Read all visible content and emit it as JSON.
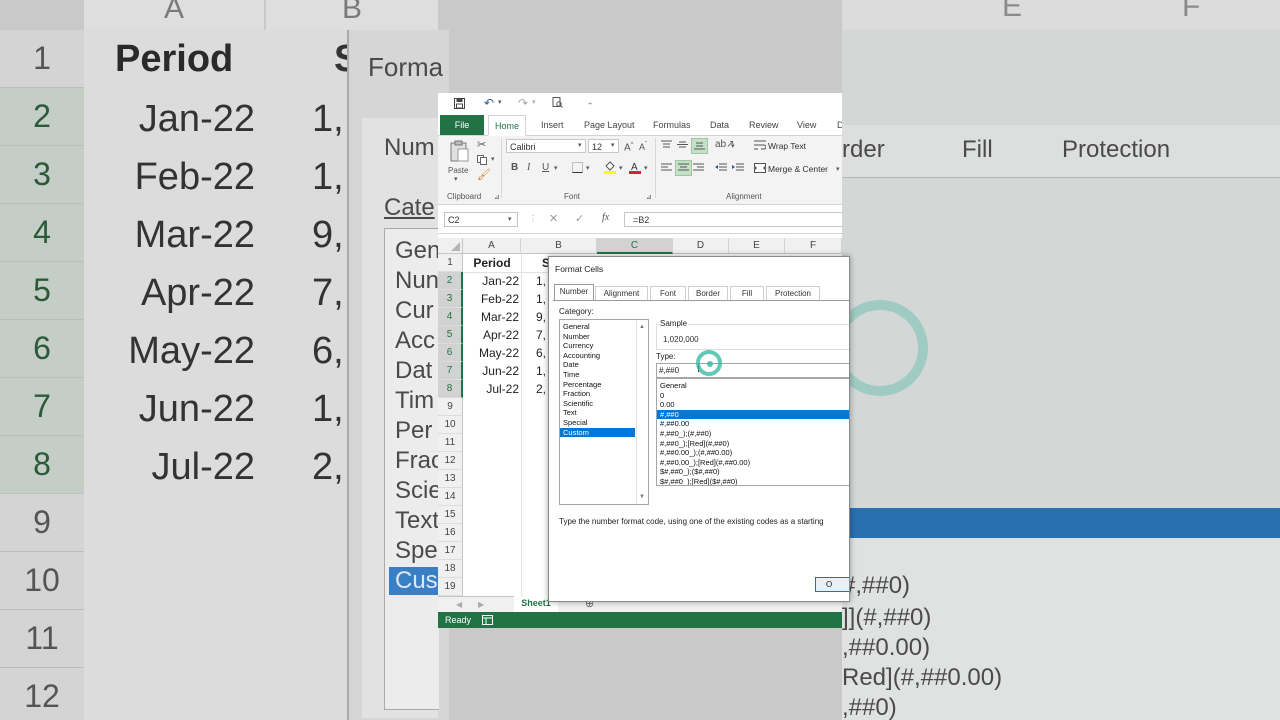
{
  "background": {
    "col_headers": [
      "A",
      "B"
    ],
    "row_numbers": [
      "1",
      "2",
      "3",
      "4",
      "5",
      "6",
      "7",
      "8",
      "9",
      "10",
      "11",
      "12"
    ],
    "period_header": "Period",
    "value_header_partial": "S",
    "periods": [
      "Jan-22",
      "Feb-22",
      "Mar-22",
      "Apr-22",
      "May-22",
      "Jun-22",
      "Jul-22"
    ],
    "value_partials": [
      "1,",
      "1,",
      "9,",
      "7,",
      "6,",
      "1,",
      "2,"
    ],
    "dialog_title_partial": "Forma",
    "number_tab_partial": "Num",
    "category_partial": "Cate",
    "category_partials": [
      "Gen",
      "Nun",
      "Cur",
      "Acc",
      "Dat",
      "Tim",
      "Per",
      "Frac",
      "Scie",
      "Text",
      "Spe",
      "Cus"
    ],
    "right_col_headers": [
      "E",
      "F"
    ],
    "right_tabs": [
      "rder",
      "Fill",
      "Protection"
    ],
    "right_list": [
      "#,##0)",
      "]](#,##0)",
      ",##0.00)",
      "Red](#,##0.00)",
      ",##0)"
    ]
  },
  "excel": {
    "tabs": [
      "File",
      "Home",
      "Insert",
      "Page Layout",
      "Formulas",
      "Data",
      "Review",
      "View",
      "D"
    ],
    "font_name": "Calibri",
    "font_size": "12",
    "paste_label": "Paste",
    "wrap_text": "Wrap Text",
    "merge_center": "Merge & Center",
    "groups": [
      "Clipboard",
      "Font",
      "Alignment"
    ],
    "name_box": "C2",
    "formula": "=B2",
    "col_headers": [
      "A",
      "B",
      "C",
      "D",
      "E",
      "F"
    ],
    "rows": [
      "1",
      "2",
      "3",
      "4",
      "5",
      "6",
      "7",
      "8",
      "9",
      "10",
      "11",
      "12",
      "13",
      "14",
      "15",
      "16",
      "17",
      "18",
      "19"
    ],
    "period_header": "Period",
    "value_header_partial": "S",
    "periods": [
      "Jan-22",
      "Feb-22",
      "Mar-22",
      "Apr-22",
      "May-22",
      "Jun-22",
      "Jul-22"
    ],
    "value_partials": [
      "1,",
      "1,",
      "9,",
      "7,",
      "6,",
      "1,",
      "2,"
    ],
    "sheet_tab": "Sheet1",
    "status": "Ready"
  },
  "dialog": {
    "title": "Format Cells",
    "tabs": [
      "Number",
      "Alignment",
      "Font",
      "Border",
      "Fill",
      "Protection"
    ],
    "category_label": "Category:",
    "categories": [
      "General",
      "Number",
      "Currency",
      "Accounting",
      "Date",
      "Time",
      "Percentage",
      "Fraction",
      "Scientific",
      "Text",
      "Special",
      "Custom"
    ],
    "selected_category": "Custom",
    "sample_label": "Sample",
    "sample_value": "1,020,000",
    "type_label": "Type:",
    "type_value": "#,##0",
    "type_list": [
      "General",
      "0",
      "0.00",
      "#,##0",
      "#,##0.00",
      "#,##0_);(#,##0)",
      "#,##0_);[Red](#,##0)",
      "#,##0.00_);(#,##0.00)",
      "#,##0.00_);[Red](#,##0.00)",
      "$#,##0_);($#,##0)",
      "$#,##0_);[Red]($#,##0)"
    ],
    "selected_type": "#,##0",
    "hint": "Type the number format code, using one of the existing codes as a starting",
    "ok_partial": "O"
  },
  "colors": {
    "excel_green": "#217346",
    "selection_blue": "#0078d7",
    "cursor_teal": "#2fb5a0"
  }
}
